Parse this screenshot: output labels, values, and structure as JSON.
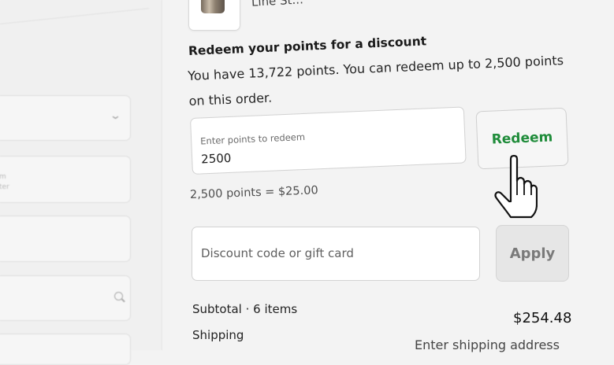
{
  "product": {
    "name": "Line St..."
  },
  "redeem": {
    "title": "Redeem your points for a discount",
    "message": "You have 13,722 points. You can redeem up to 2,500 points on this order.",
    "input_label": "Enter points to redeem",
    "input_value": "2500",
    "button_label": "Redeem",
    "conversion": "2,500 points = $25.00"
  },
  "discount": {
    "placeholder": "Discount code or gift card",
    "button_label": "Apply"
  },
  "summary": {
    "subtotal_label": "Subtotal · 6 items",
    "subtotal_value": "$254.48",
    "shipping_label": "Shipping",
    "shipping_value": "Enter shipping address"
  },
  "colors": {
    "accent": "#1f8c3a"
  },
  "icons": [
    "chevron-down-icon",
    "search-icon",
    "hand-pointer-cursor-icon"
  ]
}
